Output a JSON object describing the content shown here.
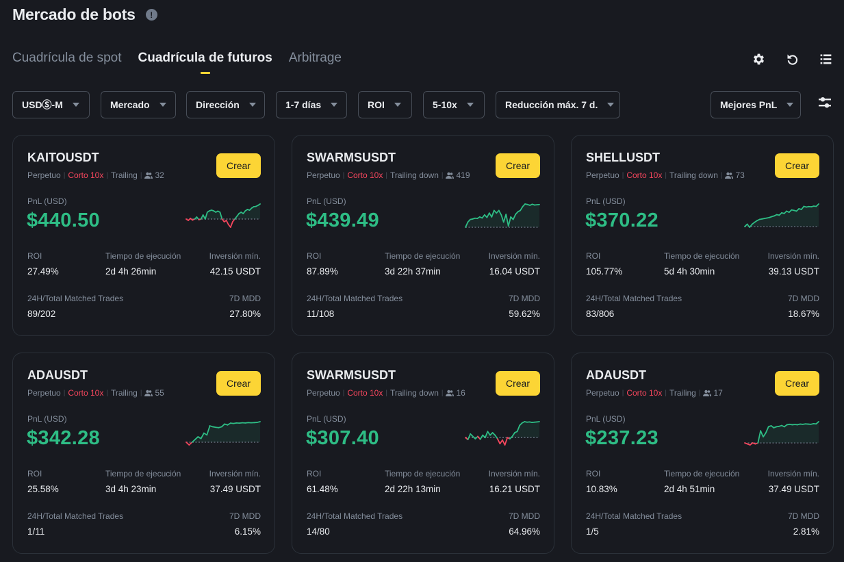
{
  "header": {
    "title": "Mercado de bots",
    "info_icon": "info-circle-icon"
  },
  "tabs": [
    {
      "label": "Cuadrícula de spot",
      "active": false
    },
    {
      "label": "Cuadrícula de futuros",
      "active": true
    },
    {
      "label": "Arbitrage",
      "active": false
    }
  ],
  "toolbar": {
    "icons": [
      "gear-icon",
      "refresh-icon",
      "list-view-icon"
    ]
  },
  "filters": [
    {
      "label": "USDⓈ-M"
    },
    {
      "label": "Mercado"
    },
    {
      "label": "Dirección"
    },
    {
      "label": "1-7 días"
    },
    {
      "label": "ROI"
    },
    {
      "label": "5-10x"
    },
    {
      "label": "Reducción máx. 7 d."
    }
  ],
  "sort": {
    "label": "Mejores PnL"
  },
  "labels": {
    "pnl": "PnL (USD)",
    "roi": "ROI",
    "runtime": "Tiempo de ejecución",
    "min_invest": "Inversión mín.",
    "trades": "24H/Total Matched Trades",
    "mdd": "7D MDD",
    "create": "Crear"
  },
  "colors": {
    "accent": "#fcd535",
    "profit": "#2ebd85",
    "loss": "#f6465d"
  },
  "cards": [
    {
      "symbol": "KAITOUSDT",
      "type": "Perpetuo",
      "direction": "Corto 10x",
      "mode": "Trailing",
      "users": "32",
      "pnl": "$440.50",
      "roi": "27.49%",
      "runtime": "2d 4h 26min",
      "min_invest": "42.15 USDT",
      "trades": "89/202",
      "mdd": "27.80%",
      "spark": [
        0,
        -1,
        0.5,
        -0.8,
        0,
        1.5,
        -0.5,
        0,
        3,
        0,
        5,
        6,
        6.5,
        6,
        5,
        5.8,
        5,
        0,
        -2,
        -1,
        -4,
        -6,
        -2,
        0,
        2,
        4,
        5,
        4,
        6,
        7,
        6.5,
        8,
        9,
        9.2,
        10,
        11
      ]
    },
    {
      "symbol": "SWARMSUSDT",
      "type": "Perpetuo",
      "direction": "Corto 10x",
      "mode": "Trailing down",
      "users": "419",
      "pnl": "$439.49",
      "roi": "87.89%",
      "runtime": "3d 22h 37min",
      "min_invest": "16.04 USDT",
      "trades": "11/108",
      "mdd": "59.62%",
      "spark": [
        0,
        2,
        3,
        3.2,
        3.5,
        3.4,
        4,
        3.6,
        4.8,
        3.8,
        5.5,
        4,
        6.5,
        5.5,
        6.5,
        4.8,
        2,
        5,
        0.5,
        4,
        3,
        5,
        6,
        6.5,
        8,
        9,
        8.8,
        8.5,
        8.9,
        8.6,
        8.7,
        8.8
      ]
    },
    {
      "symbol": "SHELLUSDT",
      "type": "Perpetuo",
      "direction": "Corto 10x",
      "mode": "Trailing down",
      "users": "73",
      "pnl": "$370.22",
      "roi": "105.77%",
      "runtime": "5d 4h 30min",
      "min_invest": "39.13 USDT",
      "trades": "83/806",
      "mdd": "18.67%",
      "spark": [
        0,
        1,
        -0.3,
        1,
        1.8,
        2.5,
        3,
        3.2,
        3.4,
        3.6,
        3.8,
        4.2,
        4.5,
        5,
        4.8,
        5.8,
        5.5,
        6.5,
        6,
        7,
        6.8,
        6.5,
        7.5,
        7.2,
        8.5,
        8.2,
        8.4,
        8.3,
        8.6,
        8.5,
        9.5
      ]
    },
    {
      "symbol": "ADAUSDT",
      "type": "Perpetuo",
      "direction": "Corto 10x",
      "mode": "Trailing",
      "users": "55",
      "pnl": "$342.28",
      "roi": "25.58%",
      "runtime": "3d 4h 23min",
      "min_invest": "37.49 USDT",
      "trades": "1/11",
      "mdd": "6.15%",
      "spark": [
        0,
        -1.5,
        0,
        1.5,
        3,
        2,
        5,
        4,
        9,
        8.5,
        8.2,
        8,
        8.5,
        10,
        9.5,
        10.5,
        10.3,
        10.6,
        10.5,
        10.7,
        10.6,
        10.8,
        10.7,
        10.8,
        10.9,
        11.3
      ]
    },
    {
      "symbol": "SWARMSUSDT",
      "type": "Perpetuo",
      "direction": "Corto 10x",
      "mode": "Trailing down",
      "users": "16",
      "pnl": "$307.40",
      "roi": "61.48%",
      "runtime": "2d 22h 13min",
      "min_invest": "16.21 USDT",
      "trades": "14/80",
      "mdd": "64.96%",
      "spark": [
        0,
        -0.8,
        1.5,
        0.5,
        -0.5,
        0.5,
        -0.7,
        1,
        0,
        2.5,
        1,
        2,
        1,
        -0.5,
        -2.5,
        -1,
        -3,
        0,
        -0.5,
        0.5,
        2,
        2.5,
        5,
        6,
        6.5,
        6.3,
        6.4,
        6.2,
        6.3,
        6.4,
        6.5
      ]
    },
    {
      "symbol": "ADAUSDT",
      "type": "Perpetuo",
      "direction": "Corto 10x",
      "mode": "Trailing",
      "users": "17",
      "pnl": "$237.23",
      "roi": "10.83%",
      "runtime": "2d 4h 51min",
      "min_invest": "37.49 USDT",
      "trades": "1/5",
      "mdd": "2.81%",
      "spark": [
        0,
        -0.5,
        -1,
        0,
        -0.5,
        0,
        6,
        3,
        5,
        8,
        8.5,
        7.5,
        8,
        8.2,
        8.6,
        8,
        9,
        9.2,
        9,
        9.1,
        9,
        9.3,
        9.2,
        9.4,
        9.3,
        9.2,
        9.5,
        9.4,
        10.5
      ]
    }
  ]
}
